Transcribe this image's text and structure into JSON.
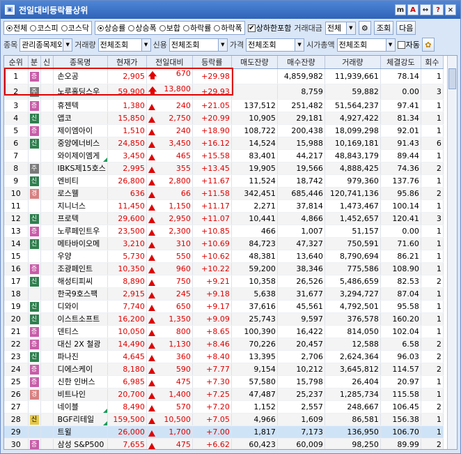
{
  "title": "전일대비등락률상위",
  "title_buttons": [
    "m",
    "A",
    "↔",
    "?",
    "×"
  ],
  "market_options": [
    {
      "label": "전체",
      "on": true
    },
    {
      "label": "코스피",
      "on": false
    },
    {
      "label": "코스닥",
      "on": false
    }
  ],
  "rate_options": [
    {
      "label": "상승률",
      "on": true
    },
    {
      "label": "상승폭",
      "on": false
    },
    {
      "label": "보합",
      "on": false
    },
    {
      "label": "하락률",
      "on": false
    },
    {
      "label": "하락폭",
      "on": false
    }
  ],
  "limit_check": {
    "label": "상하한포함",
    "checked": true
  },
  "trade_amount": {
    "label": "거래대금",
    "value": "전체"
  },
  "buttons": {
    "search": "조회",
    "next": "다음",
    "auto": "자동"
  },
  "filter_row": {
    "stock_label": "종목",
    "stock_value": "관리종목제외",
    "volume_label": "거래량",
    "volume_value": "전체조회",
    "credit_label": "신용",
    "credit_value": "전체조회",
    "price_label": "가격",
    "price_value": "전체조회",
    "cap_label": "시가총액",
    "cap_value": "전체조회"
  },
  "headers": [
    "순위",
    "분",
    "신",
    "종목명",
    "현재가",
    "전일대비",
    "등락률",
    "매도잔량",
    "매수잔량",
    "거래량",
    "체결강도",
    "회수"
  ],
  "rows": [
    [
      "1",
      "증",
      "",
      "손오공",
      "2,905",
      "670",
      "+29.98",
      "",
      "4,859,982",
      "11,939,661",
      "78.14",
      "1"
    ],
    [
      "2",
      "주",
      "",
      "노루홀딩스우",
      "59,900",
      "13,800",
      "+29.93",
      "",
      "8,759",
      "59,882",
      "0.00",
      "3"
    ],
    [
      "3",
      "증",
      "",
      "휴젠텍",
      "1,380",
      "240",
      "+21.05",
      "137,512",
      "251,482",
      "51,564,237",
      "97.41",
      "1"
    ],
    [
      "4",
      "신",
      "",
      "앱코",
      "15,850",
      "2,750",
      "+20.99",
      "10,905",
      "29,181",
      "4,927,422",
      "81.34",
      "1"
    ],
    [
      "5",
      "증",
      "",
      "제이엠아이",
      "1,510",
      "240",
      "+18.90",
      "108,722",
      "200,438",
      "18,099,298",
      "92.01",
      "1"
    ],
    [
      "6",
      "신",
      "",
      "중앙에너비스",
      "24,850",
      "3,450",
      "+16.12",
      "14,524",
      "15,988",
      "10,169,181",
      "91.43",
      "6"
    ],
    [
      "7",
      "",
      "",
      "와이제이엠게",
      "3,450",
      "465",
      "+15.58",
      "83,401",
      "44,217",
      "48,843,179",
      "89.44",
      "1"
    ],
    [
      "8",
      "주",
      "",
      "IBKS제15호스",
      "2,995",
      "355",
      "+13.45",
      "19,905",
      "19,566",
      "4,888,425",
      "74.36",
      "2"
    ],
    [
      "9",
      "신",
      "",
      "엔비티",
      "26,800",
      "2,800",
      "+11.67",
      "11,524",
      "18,742",
      "979,360",
      "137.76",
      "1"
    ],
    [
      "10",
      "경",
      "",
      "로스웰",
      "636",
      "66",
      "+11.58",
      "342,451",
      "685,446",
      "120,741,136",
      "95.86",
      "2"
    ],
    [
      "11",
      "",
      "",
      "지니너스",
      "11,450",
      "1,150",
      "+11.17",
      "2,271",
      "37,814",
      "1,473,467",
      "100.14",
      "1"
    ],
    [
      "12",
      "신",
      "",
      "프로텍",
      "29,600",
      "2,950",
      "+11.07",
      "10,441",
      "4,866",
      "1,452,657",
      "120.41",
      "3"
    ],
    [
      "13",
      "증",
      "",
      "노루페인트우",
      "23,500",
      "2,300",
      "+10.85",
      "466",
      "1,007",
      "51,157",
      "0.00",
      "1"
    ],
    [
      "14",
      "신",
      "",
      "메타바이오메",
      "3,210",
      "310",
      "+10.69",
      "84,723",
      "47,327",
      "750,591",
      "71.60",
      "1"
    ],
    [
      "15",
      "",
      "",
      "우양",
      "5,730",
      "550",
      "+10.62",
      "48,381",
      "13,640",
      "8,790,694",
      "86.21",
      "1"
    ],
    [
      "16",
      "증",
      "",
      "조광페인트",
      "10,350",
      "960",
      "+10.22",
      "59,200",
      "38,346",
      "775,586",
      "108.90",
      "1"
    ],
    [
      "17",
      "신",
      "",
      "해성티피씨",
      "8,890",
      "750",
      "+9.21",
      "10,358",
      "26,526",
      "5,486,659",
      "82.53",
      "2"
    ],
    [
      "18",
      "",
      "",
      "한국9호스팩",
      "2,915",
      "245",
      "+9.18",
      "5,638",
      "31,677",
      "3,294,727",
      "87.04",
      "1"
    ],
    [
      "19",
      "신",
      "",
      "디와이",
      "7,740",
      "650",
      "+9.17",
      "37,616",
      "45,561",
      "4,792,501",
      "95.58",
      "1"
    ],
    [
      "20",
      "신",
      "",
      "이스트소프트",
      "16,200",
      "1,350",
      "+9.09",
      "25,743",
      "9,597",
      "376,578",
      "160.20",
      "1"
    ],
    [
      "21",
      "증",
      "",
      "덴티스",
      "10,050",
      "800",
      "+8.65",
      "100,390",
      "16,422",
      "814,050",
      "102.04",
      "1"
    ],
    [
      "22",
      "증",
      "",
      "대신 2X 철광",
      "14,490",
      "1,130",
      "+8.46",
      "70,226",
      "20,457",
      "12,588",
      "6.58",
      "2"
    ],
    [
      "23",
      "신",
      "",
      "파나진",
      "4,645",
      "360",
      "+8.40",
      "13,395",
      "2,706",
      "2,624,364",
      "96.03",
      "2"
    ],
    [
      "24",
      "증",
      "",
      "디에스케이",
      "8,180",
      "590",
      "+7.77",
      "9,154",
      "10,212",
      "3,645,812",
      "114.57",
      "2"
    ],
    [
      "25",
      "증",
      "",
      "신한 인버스",
      "6,985",
      "475",
      "+7.30",
      "57,580",
      "15,798",
      "26,404",
      "20.97",
      "1"
    ],
    [
      "26",
      "경",
      "",
      "비트나인",
      "20,700",
      "1,400",
      "+7.25",
      "47,487",
      "25,237",
      "1,285,734",
      "115.58",
      "1"
    ],
    [
      "27",
      "",
      "",
      "네이블",
      "8,490",
      "570",
      "+7.20",
      "1,152",
      "2,557",
      "248,667",
      "106.45",
      "2"
    ],
    [
      "28",
      "신",
      "",
      "BGF리테일",
      "159,500",
      "10,500",
      "+7.05",
      "4,966",
      "1,609",
      "86,581",
      "156.38",
      "1"
    ],
    [
      "29",
      "",
      "",
      "트윌",
      "26,000",
      "1,700",
      "+7.00",
      "1,817",
      "7,173",
      "136,950",
      "106.70",
      "1"
    ],
    [
      "30",
      "증",
      "",
      "삼성 S&P500",
      "7,655",
      "475",
      "+6.62",
      "60,423",
      "60,009",
      "98,250",
      "89.99",
      "2"
    ]
  ]
}
